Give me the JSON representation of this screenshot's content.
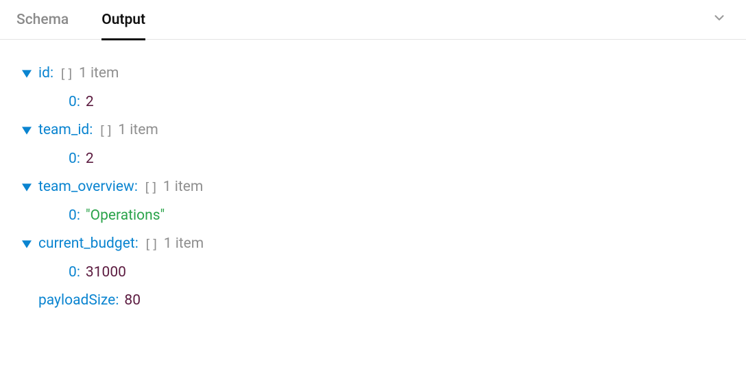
{
  "tabs": {
    "schema": "Schema",
    "output": "Output"
  },
  "tree": {
    "brackets": "[]",
    "items": [
      {
        "key": "id",
        "count_label": "1 item",
        "index_label": "0",
        "value": "2",
        "value_kind": "num"
      },
      {
        "key": "team_id",
        "count_label": "1 item",
        "index_label": "0",
        "value": "2",
        "value_kind": "num"
      },
      {
        "key": "team_overview",
        "count_label": "1 item",
        "index_label": "0",
        "value": "\"Operations\"",
        "value_kind": "str"
      },
      {
        "key": "current_budget",
        "count_label": "1 item",
        "index_label": "0",
        "value": "31000",
        "value_kind": "num"
      }
    ],
    "payload_key": "payloadSize",
    "payload_value": "80"
  }
}
